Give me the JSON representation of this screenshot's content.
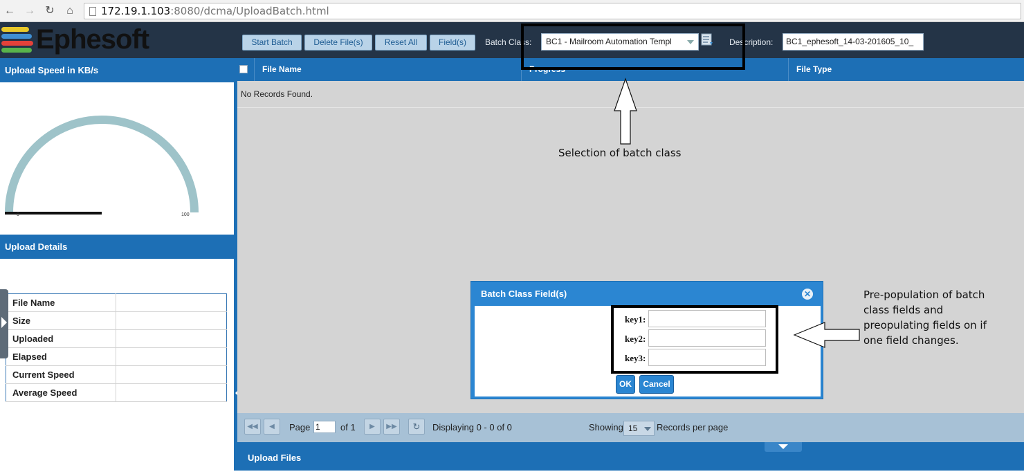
{
  "browser": {
    "url_host": "172.19.1.103",
    "url_path": ":8080/dcma/UploadBatch.html"
  },
  "header": {
    "logo_text": "Ephesoft",
    "buttons": {
      "start_batch": "Start Batch",
      "delete_files": "Delete File(s)",
      "reset_all": "Reset All",
      "fields": "Field(s)"
    },
    "batch_class_label": "Batch Class:",
    "batch_class_value": "BC1 - Mailroom Automation Templ",
    "description_label": "Description:",
    "description_value": "BC1_ephesoft_14-03-201605_10_"
  },
  "left_panel": {
    "upload_speed_title": "Upload Speed in KB/s",
    "gauge": {
      "value": 0,
      "min_label": "0",
      "max_label": "100",
      "min": 0,
      "max": 100
    },
    "upload_details_title": "Upload Details",
    "details": [
      {
        "label": "File Name",
        "value": ""
      },
      {
        "label": "Size",
        "value": ""
      },
      {
        "label": "Uploaded",
        "value": ""
      },
      {
        "label": "Elapsed",
        "value": ""
      },
      {
        "label": "Current Speed",
        "value": ""
      },
      {
        "label": "Average Speed",
        "value": ""
      }
    ]
  },
  "grid": {
    "columns": [
      "File Name",
      "Progress",
      "File Type"
    ],
    "empty_message": "No Records Found."
  },
  "pager": {
    "page_label": "Page",
    "page_value": "1",
    "of_label": "of 1",
    "displaying": "Displaying 0 - 0 of 0",
    "showing_label": "Showing",
    "per_page_value": "15",
    "records_label": "Records per page"
  },
  "upload_files": {
    "label": "Upload Files"
  },
  "dialog": {
    "title": "Batch Class Field(s)",
    "fields": [
      {
        "label": "key1:",
        "value": ""
      },
      {
        "label": "key2:",
        "value": ""
      },
      {
        "label": "key3:",
        "value": ""
      }
    ],
    "ok_label": "OK",
    "cancel_label": "Cancel"
  },
  "annotations": {
    "batch_class_note": "Selection of batch class",
    "prepopulation_note": [
      "Pre-population of batch",
      "class fields and",
      "preopulating fields on if",
      "one field changes."
    ]
  },
  "colors": {
    "brand_blue": "#1d6fb5",
    "header_bg": "#243447",
    "gauge_arc": "#9ec3c9",
    "grid_bg": "#d4d4d4"
  },
  "icons": [
    "back-icon",
    "forward-icon",
    "reload-icon",
    "home-icon",
    "page-icon",
    "dropdown-caret-icon",
    "list-select-icon",
    "close-icon",
    "first-page-icon",
    "previous-page-icon",
    "next-page-icon",
    "last-page-icon",
    "refresh-icon",
    "expand-arrow-icon",
    "collapse-arrow-icon"
  ]
}
